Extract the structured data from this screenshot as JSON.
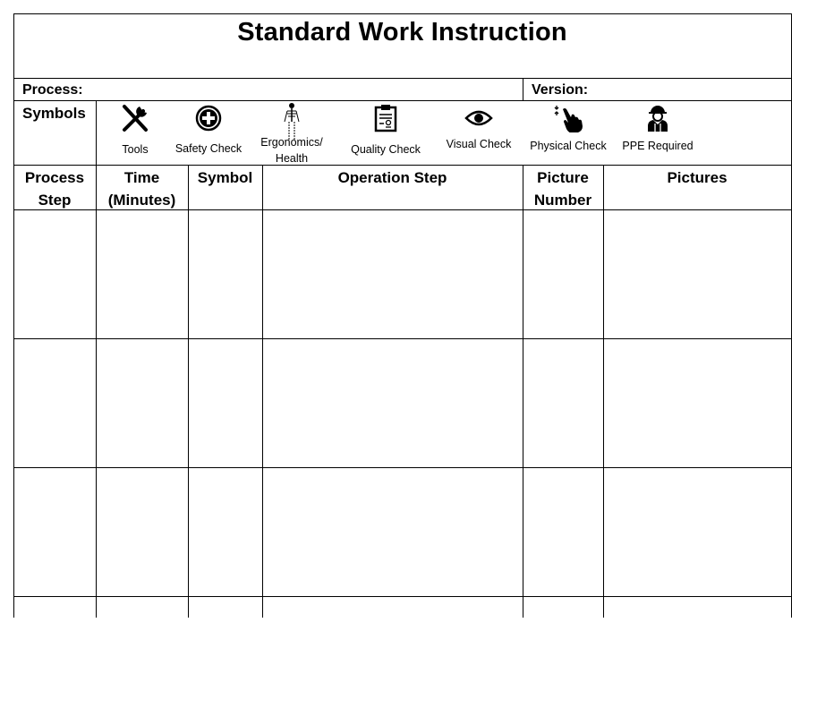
{
  "document": {
    "title": "Standard Work Instruction",
    "process_label": "Process:",
    "process_value": "",
    "version_label": "Version:",
    "version_value": "",
    "symbols_label": "Symbols",
    "symbols": [
      {
        "icon": "tools-icon",
        "label": "Tools"
      },
      {
        "icon": "safety-check-icon",
        "label": "Safety Check"
      },
      {
        "icon": "ergonomics-skeleton-icon",
        "label": "Ergonomics/ Health"
      },
      {
        "icon": "quality-check-clipboard-icon",
        "label": "Quality Check"
      },
      {
        "icon": "eye-icon",
        "label": "Visual Check"
      },
      {
        "icon": "hand-touch-icon",
        "label": "Physical Check"
      },
      {
        "icon": "worker-helmet-icon",
        "label": "PPE Required"
      }
    ],
    "columns": [
      {
        "line1": "Process",
        "line2": "Step"
      },
      {
        "line1": "Time",
        "line2": "(Minutes)"
      },
      {
        "line1": "Symbol",
        "line2": ""
      },
      {
        "line1": "Operation Step",
        "line2": ""
      },
      {
        "line1": "Picture",
        "line2": "Number"
      },
      {
        "line1": "Pictures",
        "line2": ""
      }
    ],
    "rows": [
      [
        "",
        "",
        "",
        "",
        "",
        ""
      ],
      [
        "",
        "",
        "",
        "",
        "",
        ""
      ],
      [
        "",
        "",
        "",
        "",
        "",
        ""
      ],
      [
        "",
        "",
        "",
        "",
        "",
        ""
      ]
    ]
  }
}
